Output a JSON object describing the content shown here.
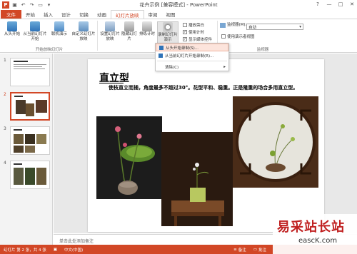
{
  "window": {
    "title": "花卉示例 [兼容模式] - PowerPoint",
    "app_icon_letter": "P",
    "controls": [
      "?",
      "—",
      "□",
      "✕"
    ]
  },
  "tabs": [
    "文件",
    "开始",
    "插入",
    "设计",
    "切换",
    "动画",
    "幻灯片放映",
    "审阅",
    "视图"
  ],
  "active_tab": "幻灯片放映",
  "ribbon": {
    "buttons": {
      "from_start": "从头开始",
      "from_current": "从当前幻灯片开始",
      "online_present": "联机演示",
      "custom_show": "自定义幻灯片放映",
      "setup_show": "设置幻灯片放映",
      "hide_slide": "隐藏幻灯片",
      "rehearse": "排练计时",
      "record": "录制幻灯片演示"
    },
    "checkboxes": {
      "play_narrations": "播放旁白",
      "use_timings": "使用计时",
      "show_media_controls": "显示媒体控件",
      "presenter_view": "使用演示者视图"
    },
    "monitor_label": "监视器(M):",
    "monitor_value": "自动",
    "groups": {
      "start_show": "开始放映幻灯片",
      "set_up": "设置",
      "monitors": "监视器"
    }
  },
  "record_menu": {
    "item1": "从头开始录制(S)...",
    "item2": "从当前幻灯片开始录制(R)...",
    "item3": "清除(C)"
  },
  "slides": [
    {
      "num": "1"
    },
    {
      "num": "2"
    },
    {
      "num": "3"
    },
    {
      "num": "4"
    }
  ],
  "selected_slide": "2",
  "slide": {
    "title": "直立型",
    "body": "使枝直立而插，角度最多不超过30°。花型平和、稳重。正是隆重的场合多用直立型。"
  },
  "notes_placeholder": "单击此处添加备注",
  "status": {
    "slide_info": "幻灯片 第 2 张，共 4 张",
    "language": "中文(中国)",
    "notes": "备注",
    "comments": "批注"
  },
  "watermark": {
    "big": "易采站长站",
    "small": "eascK.com"
  },
  "colors": {
    "accent": "#d24726",
    "ribbon_bg": "#ffffff",
    "status_bg": "#d24726",
    "watermark_red": "#c02020"
  }
}
